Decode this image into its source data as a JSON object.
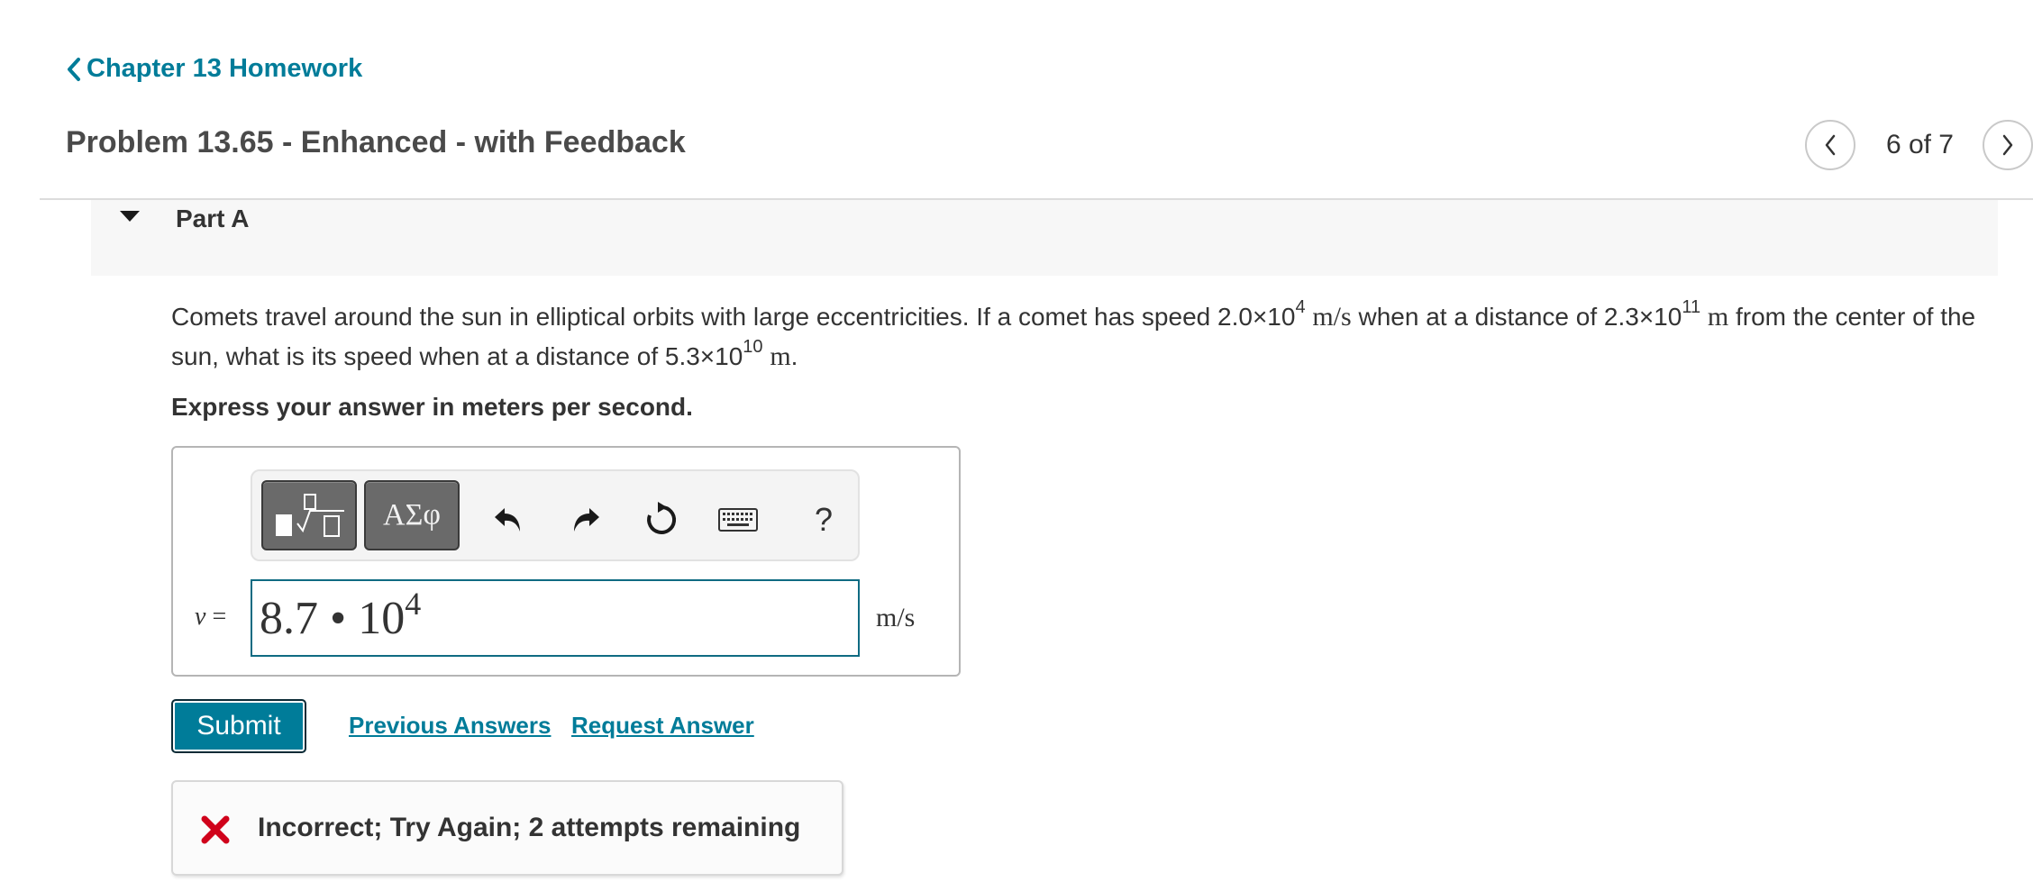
{
  "nav": {
    "back_label": "Chapter 13 Homework"
  },
  "header": {
    "title": "Problem 13.65 - Enhanced - with Feedback",
    "pager": "6 of 7"
  },
  "part": {
    "title": "Part A",
    "question": {
      "t1": "Comets travel around the sun in elliptical orbits with large eccentricities. If a comet has speed ",
      "speed_base": "2.0×10",
      "speed_exp": "4",
      "speed_unit": "m/s",
      "t2": " when at a distance of ",
      "dist1_base": "2.3×10",
      "dist1_exp": "11",
      "dist1_unit": "m",
      "t3": " from the center of the sun, what is its speed when at a distance of ",
      "dist2_base": "5.3×10",
      "dist2_exp": "10",
      "dist2_unit": "m",
      "t4": "."
    },
    "instruction": "Express your answer in meters per second."
  },
  "answer": {
    "toolbar": {
      "symbols_label": "ΑΣφ",
      "help_label": "?"
    },
    "variable": "v",
    "equals": " =",
    "value_base": "8.7 • 10",
    "value_exp": "4",
    "unit": "m/s"
  },
  "actions": {
    "submit_label": "Submit",
    "previous_answers": "Previous Answers",
    "request_answer": "Request Answer"
  },
  "feedback": {
    "message": "Incorrect; Try Again; 2 attempts remaining"
  },
  "colors": {
    "accent": "#007c99",
    "error": "#d0021b",
    "input_border": "#0f6b82"
  },
  "icons": {
    "back": "chevron-left-icon",
    "pager_prev": "chevron-left-icon",
    "pager_next": "chevron-right-icon",
    "part_toggle": "caret-down-icon",
    "undo": "undo-icon",
    "redo": "redo-icon",
    "reset": "reset-icon",
    "keyboard": "keyboard-icon",
    "feedback": "x-mark-icon"
  }
}
